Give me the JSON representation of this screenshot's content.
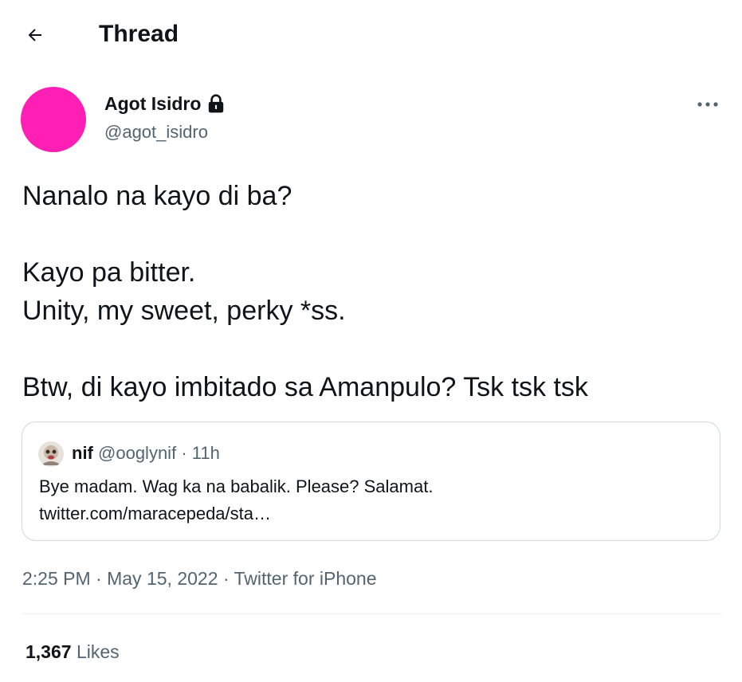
{
  "header": {
    "title": "Thread",
    "back_icon": "arrow-left-icon"
  },
  "tweet": {
    "author": {
      "display_name": "Agot Isidro",
      "handle": "@agot_isidro",
      "avatar_color": "#ff1fb4",
      "protected_icon": "lock-icon"
    },
    "more_icon": "more-horizontal-icon",
    "text_lines": [
      "Nanalo na kayo di ba?",
      "",
      "Kayo pa bitter.",
      "Unity, my sweet, perky *ss.",
      "",
      "Btw, di kayo imbitado sa Amanpulo? Tsk tsk tsk"
    ],
    "quote": {
      "name": "nif",
      "handle": "@ooglynif",
      "separator": "·",
      "time": "11h",
      "text": "Bye madam. Wag ka na babalik. Please? Salamat.",
      "link": "twitter.com/maracepeda/sta…"
    },
    "time": "2:25 PM",
    "dot": "·",
    "date": "May 15, 2022",
    "source": "Twitter for iPhone",
    "likes_count": "1,367",
    "likes_label": "Likes"
  },
  "colors": {
    "text": "#0f1419",
    "secondary": "#536471",
    "border": "#cfd9de"
  }
}
